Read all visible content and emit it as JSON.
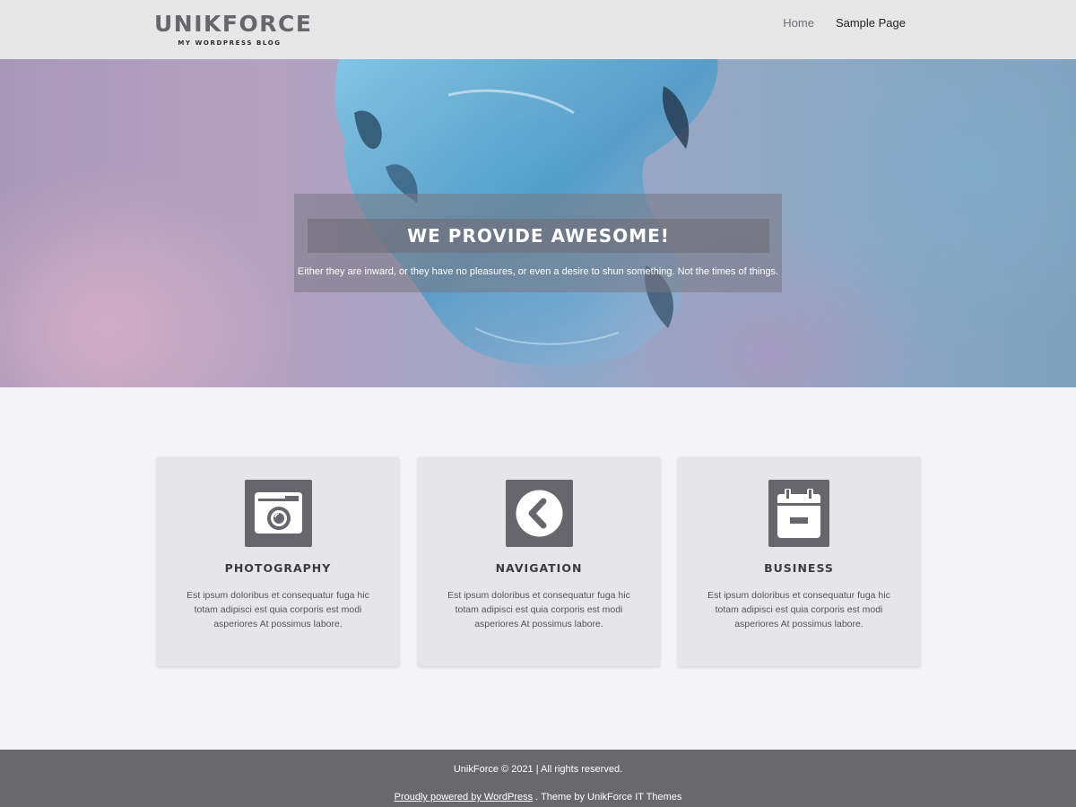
{
  "header": {
    "site_title": "UNIKFORCE",
    "tagline": "MY WORDPRESS BLOG",
    "nav": [
      {
        "label": "Home"
      },
      {
        "label": "Sample Page"
      }
    ]
  },
  "hero": {
    "title": "WE PROVIDE AWESOME!",
    "text": "Either they are inward, or they have no pleasures, or even a desire to shun something. Not the times of things."
  },
  "features": [
    {
      "icon": "camera-icon",
      "title": "PHOTOGRAPHY",
      "text": "Est ipsum doloribus et consequatur fuga hic totam adipisci est quia corporis est modi asperiores At possimus labore."
    },
    {
      "icon": "chevron-left-circle-icon",
      "title": "NAVIGATION",
      "text": "Est ipsum doloribus et consequatur fuga hic totam adipisci est quia corporis est modi asperiores At possimus labore."
    },
    {
      "icon": "calendar-icon",
      "title": "BUSINESS",
      "text": "Est ipsum doloribus et consequatur fuga hic totam adipisci est quia corporis est modi asperiores At possimus labore."
    }
  ],
  "footer": {
    "copyright": "UnikForce © 2021 | All rights reserved.",
    "powered_link": "Proudly powered by WordPress",
    "theme_credit": " . Theme by UnikForce IT Themes"
  },
  "colors": {
    "header_bg": "#e7e7e8",
    "icon_bg": "#67666c",
    "card_bg": "#e6e6e8",
    "footer_bg": "#69686d",
    "page_bg": "#f4f4f6"
  }
}
